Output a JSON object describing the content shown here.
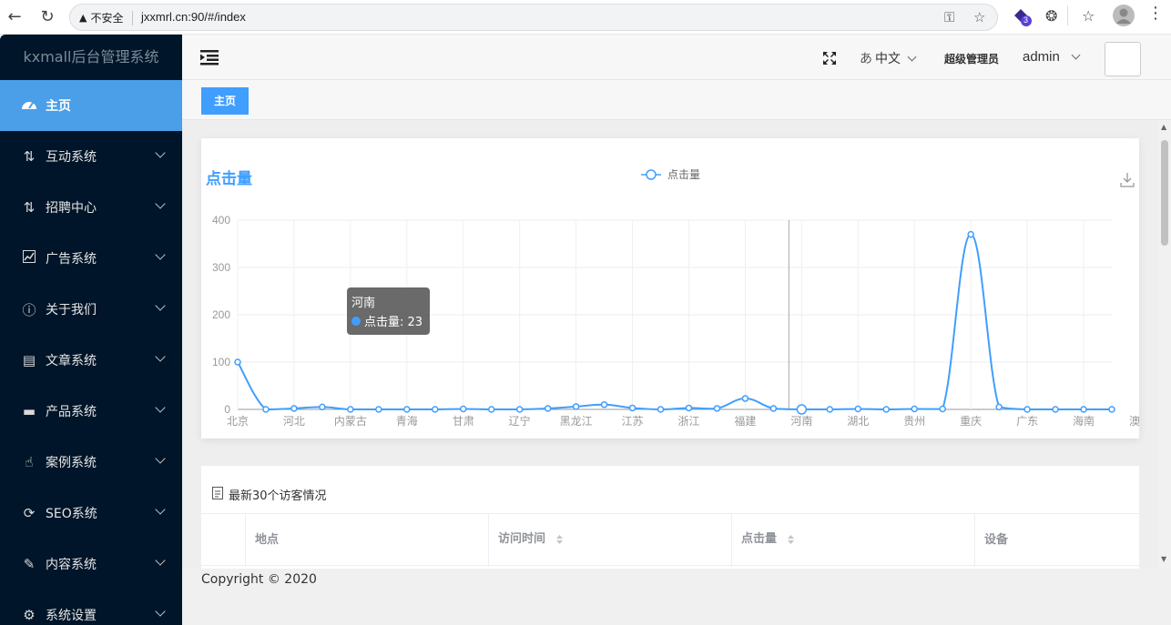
{
  "browser": {
    "security_label": "不安全",
    "url": "jxxmrl.cn:90/#/index",
    "ext_badge": "3"
  },
  "sidebar": {
    "title": "kxmall后台管理系统",
    "items": [
      {
        "label": "主页",
        "icon": "dashboard-icon",
        "active": true
      },
      {
        "label": "互动系统",
        "icon": "interaction-icon"
      },
      {
        "label": "招聘中心",
        "icon": "recruit-icon"
      },
      {
        "label": "广告系统",
        "icon": "chart-icon"
      },
      {
        "label": "关于我们",
        "icon": "info-icon"
      },
      {
        "label": "文章系统",
        "icon": "document-icon"
      },
      {
        "label": "产品系统",
        "icon": "product-icon"
      },
      {
        "label": "案例系统",
        "icon": "hand-icon"
      },
      {
        "label": "SEO系统",
        "icon": "seo-icon"
      },
      {
        "label": "内容系统",
        "icon": "edit-icon"
      },
      {
        "label": "系统设置",
        "icon": "gear-icon"
      }
    ]
  },
  "header": {
    "language": "中文",
    "role": "超级管理员",
    "username": "admin"
  },
  "tags": {
    "home": "主页"
  },
  "chart_data": {
    "type": "line",
    "title": "点击量",
    "legend": "点击量",
    "legend_position": "top-center",
    "xlabel": "",
    "ylabel": "",
    "ylim": [
      0,
      400
    ],
    "yticks": [
      "0",
      "100",
      "200",
      "300",
      "400"
    ],
    "grid": true,
    "color": "#409eff",
    "x_labels_shown": [
      "北京",
      "河北",
      "内蒙古",
      "青海",
      "甘肃",
      "辽宁",
      "黑龙江",
      "江苏",
      "浙江",
      "福建",
      "河南",
      "湖北",
      "贵州",
      "重庆",
      "广东",
      "海南",
      "澳门"
    ],
    "values": [
      100,
      0,
      2,
      5,
      0,
      0,
      0,
      0,
      1,
      0,
      0,
      2,
      6,
      10,
      3,
      0,
      3,
      2,
      23,
      2,
      0,
      0,
      1,
      0,
      1,
      1,
      370,
      5,
      0,
      0,
      0,
      0
    ],
    "tooltip": {
      "category": "河南",
      "series": "点击量",
      "value": "23",
      "text": "点击量: 23"
    }
  },
  "table": {
    "title": "最新30个访客情况",
    "columns": [
      "地点",
      "访问时间",
      "点击量",
      "设备"
    ]
  },
  "footer": {
    "copyright": "Copyright © 2020"
  }
}
